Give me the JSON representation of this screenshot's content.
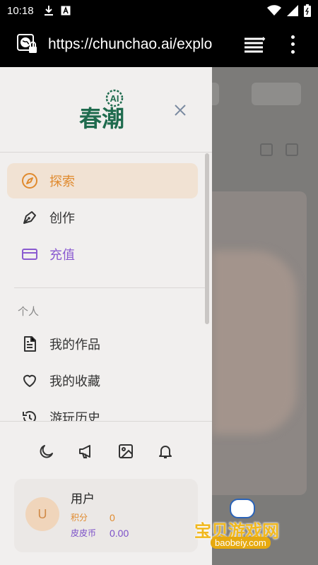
{
  "status_bar": {
    "time": "10:18"
  },
  "browser": {
    "url": "https://chunchao.ai/explo"
  },
  "drawer": {
    "logo_text": "春潮",
    "logo_badge": "AI",
    "nav": [
      {
        "label": "探索",
        "icon": "compass-icon",
        "active": true
      },
      {
        "label": "创作",
        "icon": "pen-icon"
      },
      {
        "label": "充值",
        "icon": "card-icon"
      }
    ],
    "section_personal": "个人",
    "personal": [
      {
        "label": "我的作品",
        "icon": "document-icon"
      },
      {
        "label": "我的收藏",
        "icon": "heart-icon"
      },
      {
        "label": "游玩历史",
        "icon": "history-icon"
      }
    ],
    "bottom_icons": [
      "moon-icon",
      "megaphone-icon",
      "image-icon",
      "bell-icon"
    ],
    "user": {
      "avatar_letter": "U",
      "name": "用户",
      "points_label": "积分",
      "points_value": "0",
      "coins_label": "皮皮币",
      "coins_value": "0.00"
    }
  },
  "watermark": {
    "text": "宝贝游戏网",
    "url": "baobeiy.com"
  },
  "colors": {
    "accent": "#e08a2e",
    "purple": "#8a5ad0",
    "logo_green": "#1f6b4e"
  }
}
